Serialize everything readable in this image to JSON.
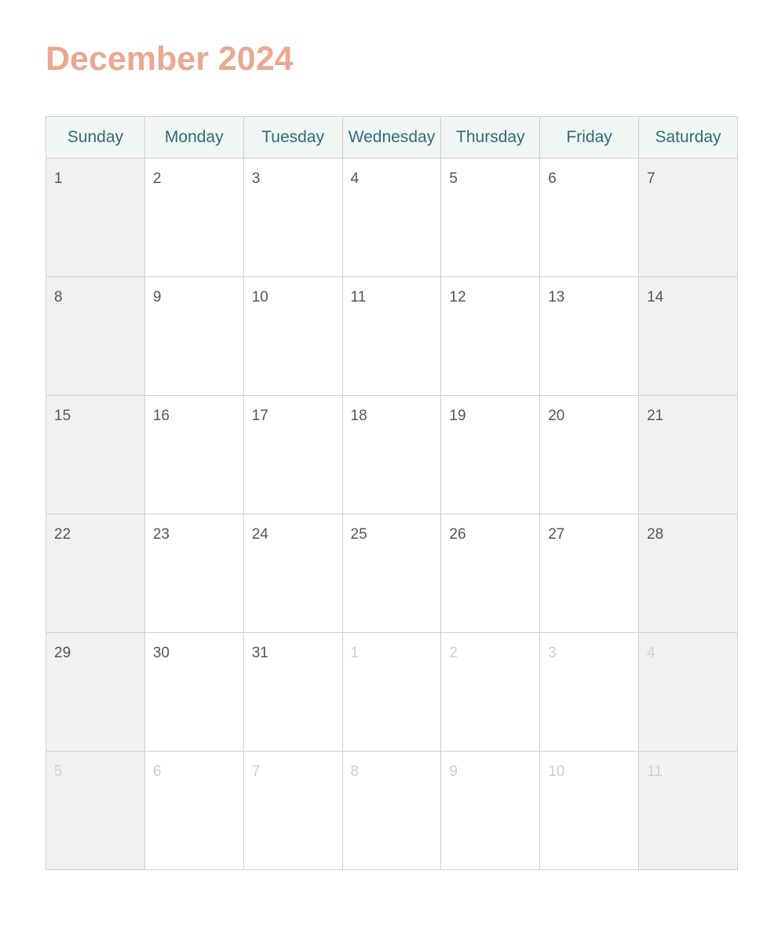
{
  "title": "December 2024",
  "colors": {
    "title": "#eaa891",
    "header_text": "#2f6b72",
    "header_bg": "#f1f7f7",
    "weekend_bg": "#f1f1f1",
    "grid_line": "#cfcfcf",
    "day_text": "#555555",
    "other_month_text": "#cfcfcf"
  },
  "weekdays": [
    "Sunday",
    "Monday",
    "Tuesday",
    "Wednesday",
    "Thursday",
    "Friday",
    "Saturday"
  ],
  "weeks": [
    [
      {
        "day": "1",
        "current": true
      },
      {
        "day": "2",
        "current": true
      },
      {
        "day": "3",
        "current": true
      },
      {
        "day": "4",
        "current": true
      },
      {
        "day": "5",
        "current": true
      },
      {
        "day": "6",
        "current": true
      },
      {
        "day": "7",
        "current": true
      }
    ],
    [
      {
        "day": "8",
        "current": true
      },
      {
        "day": "9",
        "current": true
      },
      {
        "day": "10",
        "current": true
      },
      {
        "day": "11",
        "current": true
      },
      {
        "day": "12",
        "current": true
      },
      {
        "day": "13",
        "current": true
      },
      {
        "day": "14",
        "current": true
      }
    ],
    [
      {
        "day": "15",
        "current": true
      },
      {
        "day": "16",
        "current": true
      },
      {
        "day": "17",
        "current": true
      },
      {
        "day": "18",
        "current": true
      },
      {
        "day": "19",
        "current": true
      },
      {
        "day": "20",
        "current": true
      },
      {
        "day": "21",
        "current": true
      }
    ],
    [
      {
        "day": "22",
        "current": true
      },
      {
        "day": "23",
        "current": true
      },
      {
        "day": "24",
        "current": true
      },
      {
        "day": "25",
        "current": true
      },
      {
        "day": "26",
        "current": true
      },
      {
        "day": "27",
        "current": true
      },
      {
        "day": "28",
        "current": true
      }
    ],
    [
      {
        "day": "29",
        "current": true
      },
      {
        "day": "30",
        "current": true
      },
      {
        "day": "31",
        "current": true
      },
      {
        "day": "1",
        "current": false
      },
      {
        "day": "2",
        "current": false
      },
      {
        "day": "3",
        "current": false
      },
      {
        "day": "4",
        "current": false
      }
    ],
    [
      {
        "day": "5",
        "current": false
      },
      {
        "day": "6",
        "current": false
      },
      {
        "day": "7",
        "current": false
      },
      {
        "day": "8",
        "current": false
      },
      {
        "day": "9",
        "current": false
      },
      {
        "day": "10",
        "current": false
      },
      {
        "day": "11",
        "current": false
      }
    ]
  ]
}
